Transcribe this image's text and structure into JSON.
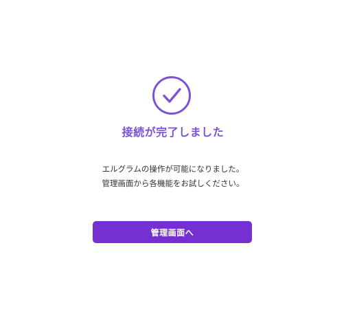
{
  "colors": {
    "accent": "#7b52d6",
    "button": "#7530d2",
    "text": "#333333",
    "background": "#ffffff"
  },
  "status": {
    "icon": "check-circle-icon",
    "title": "接続が完了しました"
  },
  "message": {
    "line1": "エルグラムの操作が可能になりました。",
    "line2": "管理画面から各機能をお試しください。"
  },
  "actions": {
    "primary_label": "管理画面へ"
  }
}
